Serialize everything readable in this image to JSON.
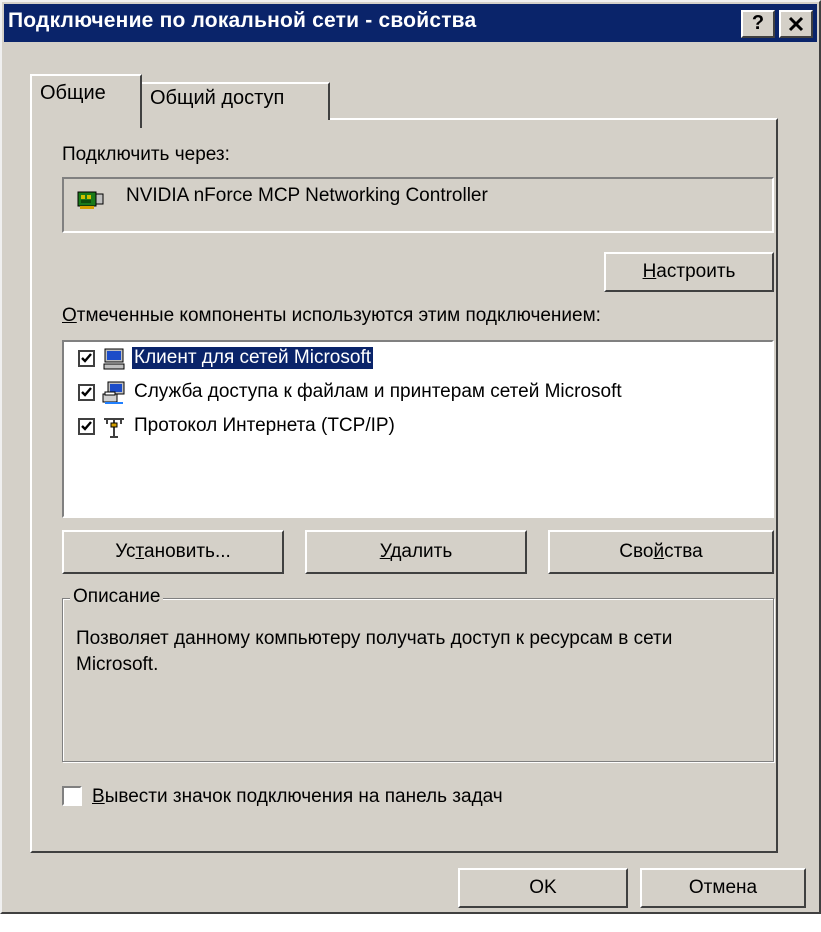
{
  "window": {
    "title": "Подключение по локальной сети - свойства",
    "help_label": "?",
    "close_label": "×"
  },
  "tabs": [
    {
      "label": "Общие",
      "active": true
    },
    {
      "label": "Общий доступ",
      "active": false
    }
  ],
  "connect_via": {
    "label": "Подключить через:",
    "adapter_name": "NVIDIA nForce MCP Networking Controller",
    "adapter_icon": "network-adapter-icon"
  },
  "configure_button": {
    "mnemonic": "Н",
    "rest": "астроить"
  },
  "components": {
    "label_mnemonic": "О",
    "label_rest": "тмеченные компоненты используются этим подключением:",
    "items": [
      {
        "label": "Клиент для сетей Microsoft",
        "checked": true,
        "selected": true,
        "icon": "network-client-icon"
      },
      {
        "label": "Служба доступа к файлам и принтерам сетей Microsoft",
        "checked": true,
        "selected": false,
        "icon": "file-printer-sharing-icon"
      },
      {
        "label": "Протокол Интернета (TCP/IP)",
        "checked": true,
        "selected": false,
        "icon": "protocol-icon"
      }
    ]
  },
  "buttons": {
    "install": {
      "pre": "Ус",
      "mnemonic": "т",
      "post": "ановить..."
    },
    "uninstall": {
      "pre": "",
      "mnemonic": "У",
      "post": "далить"
    },
    "properties": {
      "pre": "Сво",
      "mnemonic": "й",
      "post": "ства"
    }
  },
  "description": {
    "title": "Описание",
    "text": "Позволяет данному компьютеру получать доступ к ресурсам в сети Microsoft."
  },
  "taskbar_checkbox": {
    "mnemonic": "В",
    "rest": "ывести значок подключения на панель задач",
    "checked": false
  },
  "dialog_buttons": {
    "ok": "OK",
    "cancel": "Отмена"
  },
  "colors": {
    "titlebar": "#0a246a",
    "face": "#d4d0c8",
    "selection": "#0a246a"
  }
}
